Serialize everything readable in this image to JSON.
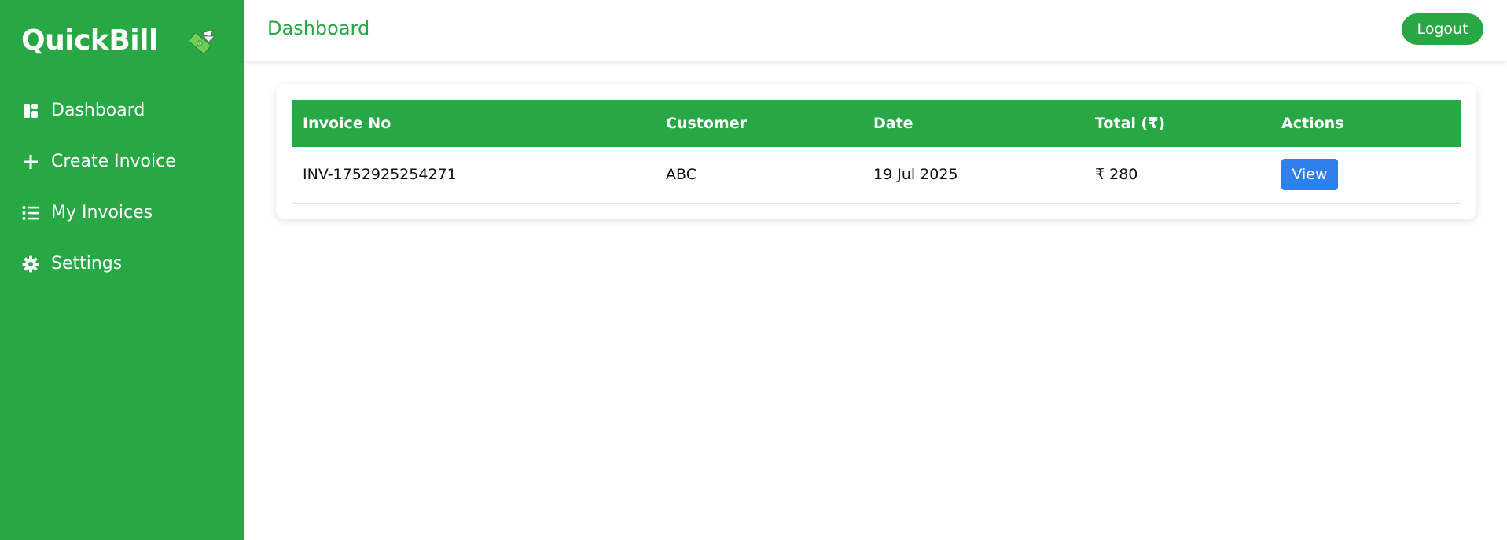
{
  "app": {
    "brand_name": "QuickBill",
    "brand_logo_icon": "money-wings-icon"
  },
  "colors": {
    "primary": "#28a745",
    "action_blue": "#2f80ed",
    "text": "#111111",
    "background": "#ffffff"
  },
  "sidebar": {
    "items": [
      {
        "label": "Dashboard",
        "icon": "dashboard-icon"
      },
      {
        "label": "Create Invoice",
        "icon": "plus-icon"
      },
      {
        "label": "My Invoices",
        "icon": "list-icon"
      },
      {
        "label": "Settings",
        "icon": "gear-icon"
      }
    ]
  },
  "header": {
    "title": "Dashboard",
    "logout_label": "Logout"
  },
  "invoices_table": {
    "columns": [
      "Invoice No",
      "Customer",
      "Date",
      "Total (₹)",
      "Actions"
    ],
    "rows": [
      {
        "invoice_no": "INV-1752925254271",
        "customer": "ABC",
        "date": "19 Jul 2025",
        "total": "₹ 280",
        "action_label": "View"
      }
    ]
  }
}
